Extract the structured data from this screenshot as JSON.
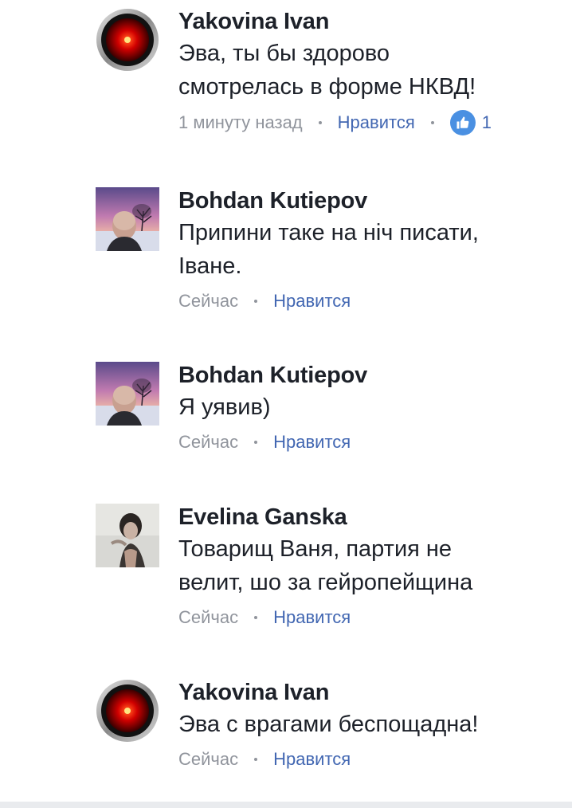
{
  "comments": [
    {
      "author": "Yakovina Ivan",
      "avatar": "hal9000-red-eye-icon",
      "text_lines": [
        "Эва, ты бы здорово",
        "смотрелась в форме НКВД!"
      ],
      "time": "1 минуту назад",
      "like_label": "Нравится",
      "like_count": "1"
    },
    {
      "author": "Bohdan Kutiepov",
      "avatar": "winter-sunset-selfie-photo",
      "text_lines": [
        "Припини таке на ніч писати,",
        "Іване."
      ],
      "time": "Сейчас",
      "like_label": "Нравится"
    },
    {
      "author": "Bohdan Kutiepov",
      "avatar": "winter-sunset-selfie-photo",
      "text_lines": [
        "Я уявив)"
      ],
      "time": "Сейчас",
      "like_label": "Нравится"
    },
    {
      "author": "Evelina Ganska",
      "avatar": "woman-portrait-photo",
      "text_lines": [
        "Товарищ Ваня, партия не",
        "велит, шо за гейропейщина"
      ],
      "time": "Сейчас",
      "like_label": "Нравится"
    },
    {
      "author": "Yakovina Ivan",
      "avatar": "hal9000-red-eye-icon",
      "text_lines": [
        "Эва с врагами беспощадна!"
      ],
      "time": "Сейчас",
      "like_label": "Нравится"
    }
  ],
  "colors": {
    "author": "#1d2129",
    "meta": "#90949c",
    "like_link": "#4267b2",
    "like_badge": "#4a90e2"
  }
}
